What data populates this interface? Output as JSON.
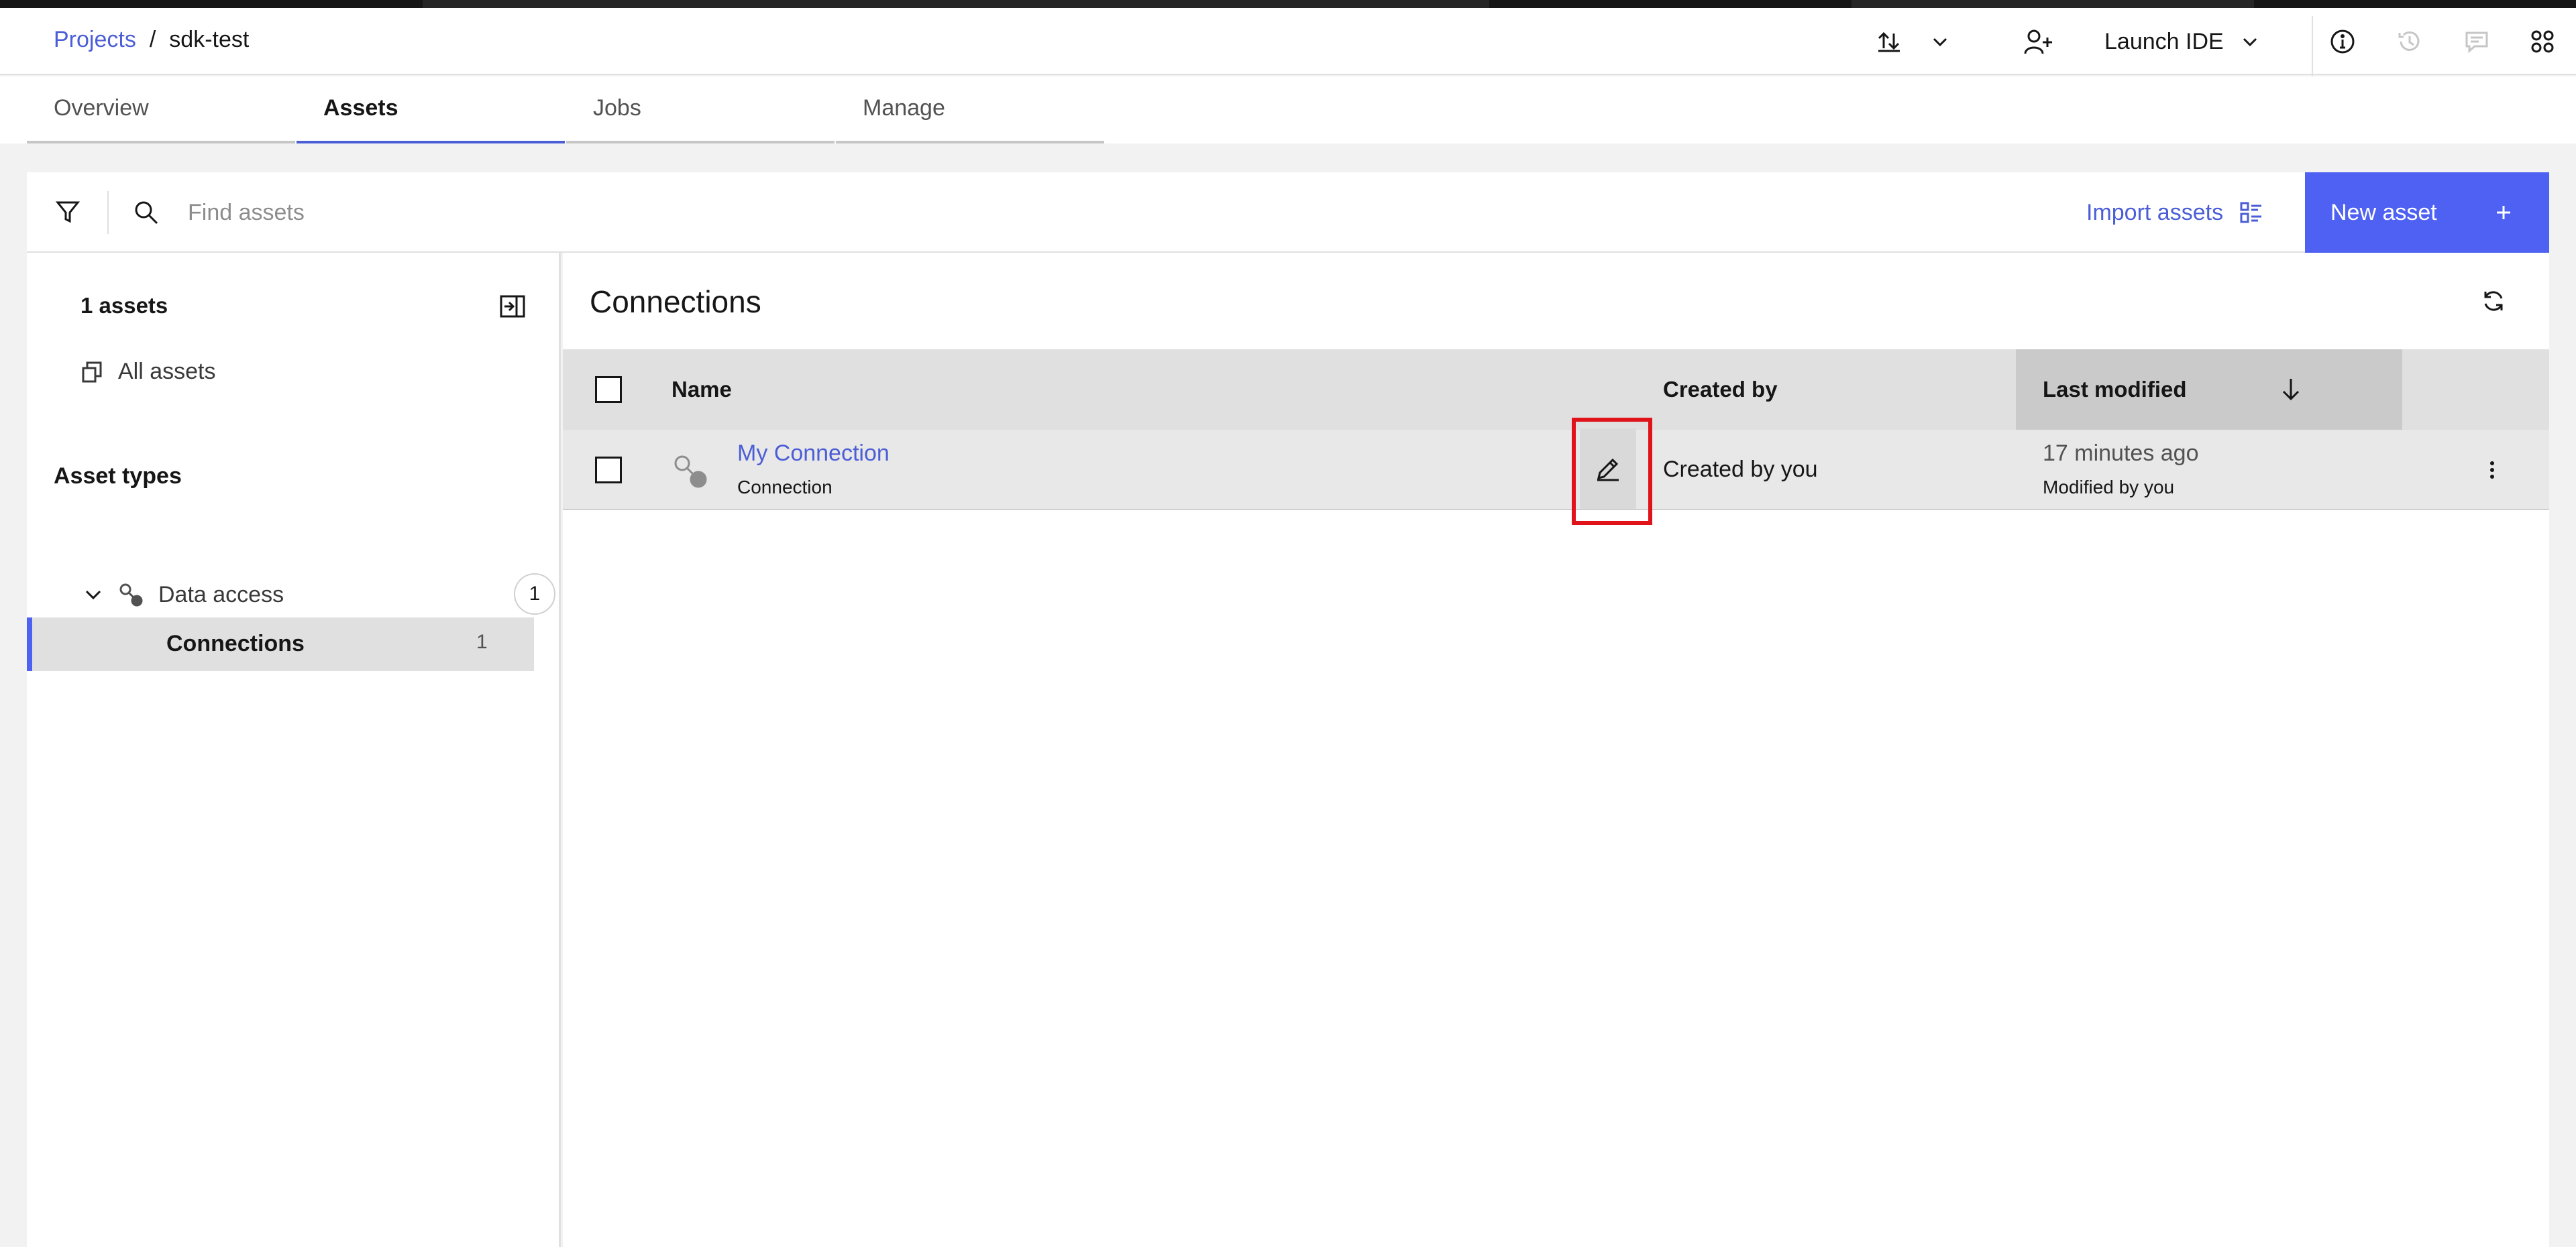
{
  "header": {
    "breadcrumb_root": "Projects",
    "breadcrumb_separator": "/",
    "project_name": "sdk-test",
    "launch_label": "Launch IDE"
  },
  "tabs": [
    {
      "label": "Overview",
      "active": false
    },
    {
      "label": "Assets",
      "active": true
    },
    {
      "label": "Jobs",
      "active": false
    },
    {
      "label": "Manage",
      "active": false
    }
  ],
  "toolbar": {
    "search_placeholder": "Find assets",
    "import_label": "Import assets",
    "new_asset_label": "New asset"
  },
  "sidebar": {
    "asset_count": "1 assets",
    "all_assets_label": "All assets",
    "asset_types_heading": "Asset types",
    "groups": [
      {
        "label": "Data access",
        "count": "1",
        "expanded": true,
        "items": [
          {
            "label": "Connections",
            "count": "1",
            "selected": true
          }
        ]
      }
    ]
  },
  "main": {
    "title": "Connections",
    "columns": {
      "name": "Name",
      "created_by": "Created by",
      "last_modified": "Last modified"
    },
    "rows": [
      {
        "name": "My Connection",
        "type": "Connection",
        "created_by": "Created by you",
        "last_modified": "17 minutes ago",
        "modified_by": "Modified by you"
      }
    ]
  },
  "colors": {
    "accent": "#4e61f2",
    "link": "#4b5ed6",
    "highlight_border": "#e0131b"
  }
}
